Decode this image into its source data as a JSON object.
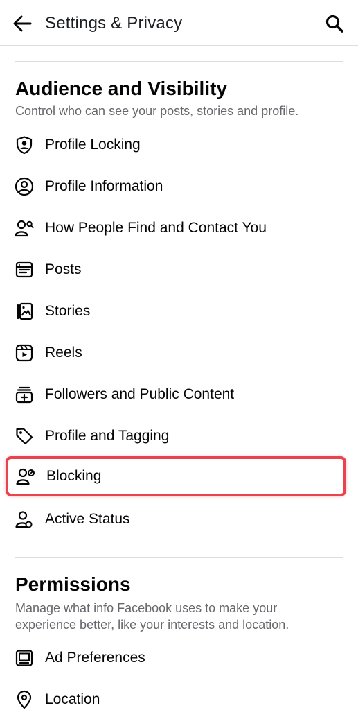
{
  "header": {
    "title": "Settings & Privacy",
    "back_icon": "arrow-left-icon",
    "search_icon": "search-icon"
  },
  "audience": {
    "title": "Audience and Visibility",
    "description": "Control who can see your posts, stories and profile.",
    "items": [
      {
        "label": "Profile Locking",
        "icon": "shield-user-icon"
      },
      {
        "label": "Profile Information",
        "icon": "user-circle-icon"
      },
      {
        "label": "How People Find and Contact You",
        "icon": "user-search-icon"
      },
      {
        "label": "Posts",
        "icon": "post-card-icon"
      },
      {
        "label": "Stories",
        "icon": "stories-icon"
      },
      {
        "label": "Reels",
        "icon": "reels-icon"
      },
      {
        "label": "Followers and Public Content",
        "icon": "followers-icon"
      },
      {
        "label": "Profile and Tagging",
        "icon": "tag-icon"
      },
      {
        "label": "Blocking",
        "icon": "user-block-icon",
        "highlighted": true
      },
      {
        "label": "Active Status",
        "icon": "user-active-icon"
      }
    ]
  },
  "permissions": {
    "title": "Permissions",
    "description": "Manage what info Facebook uses to make your experience better, like your interests and location.",
    "items": [
      {
        "label": "Ad Preferences",
        "icon": "ad-preferences-icon"
      },
      {
        "label": "Location",
        "icon": "location-pin-icon"
      }
    ]
  },
  "colors": {
    "highlight_border": "#e8434f",
    "secondary_text": "#65676b",
    "divider": "#dadde1"
  }
}
